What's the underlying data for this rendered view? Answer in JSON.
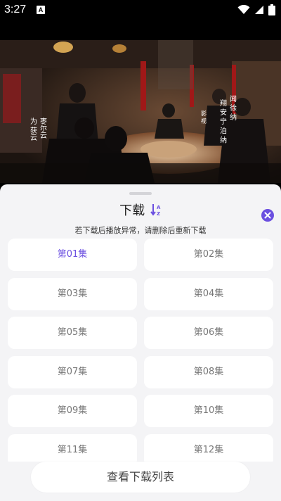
{
  "status": {
    "time": "3:27",
    "notif_letter": "A"
  },
  "video": {
    "subtitle_left": [
      "枣尔云",
      "为 获云"
    ],
    "subtitle_right": [
      "闻 徐 纳",
      "翔 安 宁 泊 纳",
      "影 视"
    ]
  },
  "sheet": {
    "title": "下载",
    "notice": "若下载后播放异常，请删除后重新下载",
    "episodes": [
      {
        "label": "第01集",
        "selected": true
      },
      {
        "label": "第02集",
        "selected": false
      },
      {
        "label": "第03集",
        "selected": false
      },
      {
        "label": "第04集",
        "selected": false
      },
      {
        "label": "第05集",
        "selected": false
      },
      {
        "label": "第06集",
        "selected": false
      },
      {
        "label": "第07集",
        "selected": false
      },
      {
        "label": "第08集",
        "selected": false
      },
      {
        "label": "第09集",
        "selected": false
      },
      {
        "label": "第10集",
        "selected": false
      },
      {
        "label": "第11集",
        "selected": false
      },
      {
        "label": "第12集",
        "selected": false
      }
    ],
    "view_list_label": "查看下载列表",
    "accent_color": "#6b4fe0"
  }
}
